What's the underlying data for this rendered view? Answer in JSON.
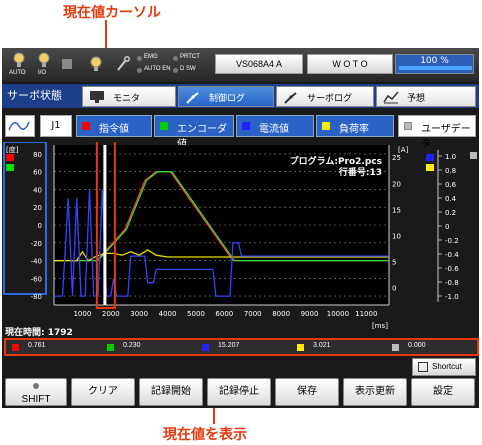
{
  "annotations": {
    "top": "現在値カーソル",
    "bottom": "現在値を表示"
  },
  "status": {
    "auto_label": "AUTO",
    "io_label": "I/O",
    "leds": [
      "EMG",
      "PRTCT",
      "AUTO EN",
      "D SW"
    ],
    "model": "VS068A4 A",
    "program": "W O T O",
    "percent": "100 %",
    "percent_value": 1.0
  },
  "tabs": {
    "title": "サーボ状態",
    "items": [
      "モニタ",
      "制御ログ",
      "サーボログ",
      "予想"
    ],
    "active": 1
  },
  "legend": {
    "joint": "J1",
    "series": [
      {
        "label": "指令値",
        "color": "#ff0000"
      },
      {
        "label": "エンコーダ値",
        "color": "#00cc00"
      },
      {
        "label": "電流値",
        "color": "#2222ff"
      },
      {
        "label": "負荷率",
        "color": "#ffee00"
      }
    ],
    "userdata_label": "ユーザデータ",
    "userdata_color": "#bbbbbb"
  },
  "chart_data": {
    "type": "line",
    "left_unit": "[度]",
    "right_unit": "[A]",
    "time_unit": "[ms]",
    "annotation_lines": [
      "プログラム:Pro2.pcs",
      "行番号:13"
    ],
    "left_ticks": [
      80,
      60,
      40,
      20,
      0,
      -20,
      -40,
      -60,
      -80
    ],
    "mid_ticks": [
      25,
      20,
      15,
      10,
      5,
      0
    ],
    "right_ticks": [
      1.0,
      0.8,
      0.6,
      0.4,
      0.2,
      0,
      -0.2,
      -0.4,
      -0.6,
      -0.8,
      -1.0
    ],
    "x_ticks": [
      1000,
      2000,
      3000,
      4000,
      5000,
      6000,
      7000,
      8000,
      9000,
      10000,
      11000
    ],
    "xlim": [
      0,
      11800
    ],
    "ylim": [
      -90,
      90
    ],
    "cursor_x": 1792,
    "series": [
      {
        "name": "指令値",
        "color": "#ff3030",
        "points": [
          [
            0,
            -40
          ],
          [
            1500,
            -40
          ],
          [
            2500,
            -5
          ],
          [
            3200,
            50
          ],
          [
            3600,
            60
          ],
          [
            4100,
            60
          ],
          [
            6300,
            -40
          ],
          [
            11800,
            -40
          ]
        ]
      },
      {
        "name": "エンコーダ値",
        "color": "#30dd30",
        "points": [
          [
            0,
            -40
          ],
          [
            1550,
            -40
          ],
          [
            2550,
            -5
          ],
          [
            3250,
            50
          ],
          [
            3650,
            60
          ],
          [
            4150,
            60
          ],
          [
            6350,
            -40
          ],
          [
            11800,
            -40
          ]
        ]
      },
      {
        "name": "負荷率",
        "color": "#eedd00",
        "points": [
          [
            0,
            -40
          ],
          [
            800,
            -40
          ],
          [
            1000,
            -30
          ],
          [
            1200,
            -40
          ],
          [
            1500,
            -35
          ],
          [
            1800,
            -32
          ],
          [
            2100,
            -32
          ],
          [
            2400,
            -34
          ],
          [
            2700,
            -30
          ],
          [
            3000,
            -34
          ],
          [
            3300,
            -28
          ],
          [
            3600,
            -34
          ],
          [
            4000,
            -36
          ],
          [
            5000,
            -36
          ],
          [
            6000,
            -36
          ],
          [
            7000,
            -36
          ],
          [
            11800,
            -36
          ]
        ]
      },
      {
        "name": "電流値",
        "color": "#3344ff",
        "points": [
          [
            0,
            -80
          ],
          [
            300,
            -80
          ],
          [
            500,
            30
          ],
          [
            650,
            -80
          ],
          [
            800,
            30
          ],
          [
            950,
            -80
          ],
          [
            1100,
            -80
          ],
          [
            1250,
            40
          ],
          [
            1400,
            -80
          ],
          [
            1550,
            -80
          ],
          [
            1700,
            40
          ],
          [
            1850,
            -80
          ],
          [
            2000,
            -80
          ],
          [
            2100,
            -60
          ],
          [
            2200,
            -80
          ],
          [
            2600,
            -80
          ],
          [
            2700,
            -35
          ],
          [
            3200,
            -35
          ],
          [
            3300,
            -65
          ],
          [
            3500,
            -65
          ],
          [
            3600,
            -50
          ],
          [
            5600,
            -50
          ],
          [
            5700,
            -80
          ],
          [
            6200,
            -80
          ],
          [
            6300,
            -20
          ],
          [
            6500,
            -20
          ],
          [
            6600,
            -35
          ],
          [
            11800,
            -35
          ]
        ]
      }
    ]
  },
  "current_time": {
    "label": "現在時間: 1792"
  },
  "values": [
    {
      "text": "0.761",
      "color": "#ff0000"
    },
    {
      "text": "0.230",
      "color": "#00cc00"
    },
    {
      "text": "15.207",
      "color": "#2222ff"
    },
    {
      "text": "3.021",
      "color": "#ffee00"
    },
    {
      "text": "0.000",
      "color": "#bbbbbb"
    }
  ],
  "shortcut_label": "Shortcut",
  "buttons": [
    "SHIFT",
    "クリア",
    "記録開始",
    "記録停止",
    "保存",
    "表示更新",
    "設定"
  ]
}
